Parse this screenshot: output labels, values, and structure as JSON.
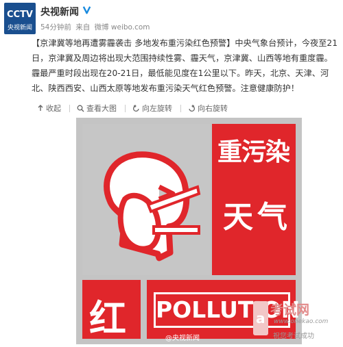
{
  "post": {
    "username": "央视新闻",
    "time": "54分钟前",
    "source_prefix": "来自",
    "source": "微博 weibo.com",
    "text": "【京津冀等地再遭雾霾袭击 多地发布重污染红色预警】中央气象台预计，今夜至21日，京津冀及周边将出现大范围持续性雾、霾天气，京津冀、山西等地有重度霾。霾最严重时段出现在20-21日，最低能见度在1公里以下。昨天，北京、天津、河北、陕西西安、山西太原等地发布重污染天气红色预警。注意健康防护！"
  },
  "avatar": {
    "logo_text": "CCTV",
    "channel_text": "央视新闻"
  },
  "toolbar": {
    "collapse_label": "收起",
    "view_large_label": "查看大图",
    "rotate_left_label": "向左旋转",
    "rotate_right_label": "向右旋转"
  },
  "image": {
    "heavy_pollution": "重污染",
    "weather": "天气",
    "red_char": "红",
    "pollution_word": "POLLUTION",
    "watermark_bottom": "@央视新闻",
    "watermark_site": "考试网",
    "watermark_url": "www.onekao.com",
    "watermark_slogan": "祝您考试成功"
  },
  "colors": {
    "alert_red": "#e0262b",
    "panel_gray": "#c4c4c4",
    "verified_blue": "#1a8bdf"
  }
}
